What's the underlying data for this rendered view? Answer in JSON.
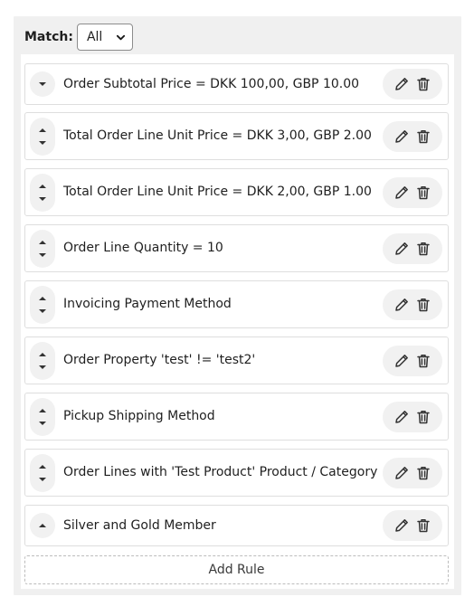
{
  "match": {
    "label": "Match:",
    "selected": "All",
    "icon": "chevron-down-icon"
  },
  "rules": [
    {
      "label": "Order Subtotal Price = DKK 100,00, GBP 10.00",
      "handle_icon": "move-down-icon"
    },
    {
      "label": "Total Order Line Unit Price = DKK 3,00, GBP 2.00",
      "handle_icon": "move-up-down-icon"
    },
    {
      "label": "Total Order Line Unit Price = DKK 2,00, GBP 1.00",
      "handle_icon": "move-up-down-icon"
    },
    {
      "label": "Order Line Quantity = 10",
      "handle_icon": "move-up-down-icon"
    },
    {
      "label": "Invoicing Payment Method",
      "handle_icon": "move-up-down-icon"
    },
    {
      "label": "Order Property 'test' != 'test2'",
      "handle_icon": "move-up-down-icon"
    },
    {
      "label": "Pickup Shipping Method",
      "handle_icon": "move-up-down-icon"
    },
    {
      "label": "Order Lines with 'Test Product' Product / Category",
      "handle_icon": "move-up-down-icon"
    },
    {
      "label": "Silver and Gold Member",
      "handle_icon": "move-up-icon"
    }
  ],
  "actions": {
    "edit_icon": "pencil-icon",
    "delete_icon": "trash-icon"
  },
  "add_rule": {
    "label": "Add Rule"
  }
}
